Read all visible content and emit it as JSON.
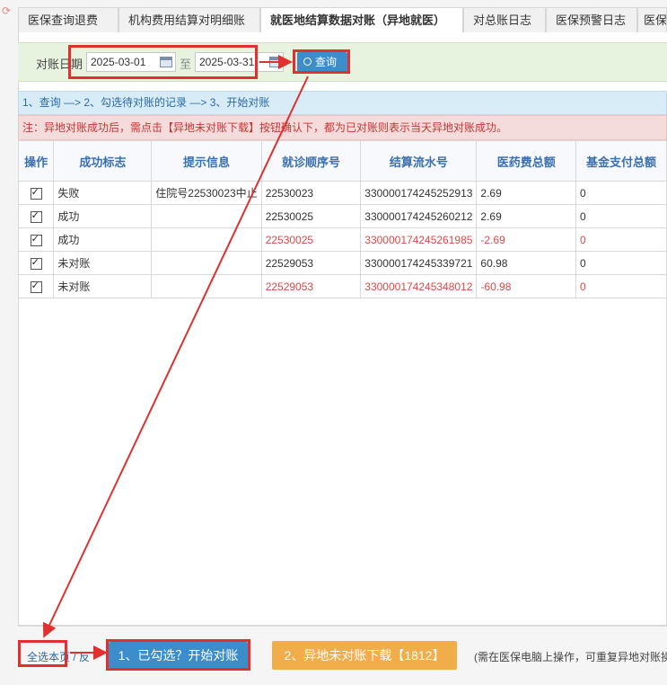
{
  "tabs": [
    {
      "label": "医保查询退费"
    },
    {
      "label": "机构费用结算对明细账"
    },
    {
      "label": "就医地结算数据对账（异地就医）"
    },
    {
      "label": "对总账日志"
    },
    {
      "label": "医保预警日志"
    },
    {
      "label": "医保"
    }
  ],
  "search": {
    "date_label": "对账日期",
    "start_date": "2025-03-01",
    "separator": "至",
    "end_date": "2025-03-31",
    "query_button": "查询"
  },
  "steps_text": "1、查询  —> 2、勾选待对账的记录  —> 3、开始对账",
  "note_text": "注：异地对账成功后，需点击【异地未对账下载】按钮确认下，都为已对账则表示当天异地对账成功。",
  "table": {
    "columns": [
      "操作",
      "成功标志",
      "提示信息",
      "就诊顺序号",
      "结算流水号",
      "医药费总额",
      "基金支付总额"
    ],
    "rows": [
      {
        "status": "失败",
        "status_type": "fail",
        "info": "住院号22530023中止",
        "visit_no": "22530023",
        "serial": "330000174245252913",
        "total": "2.69",
        "fund": "0",
        "negative": false
      },
      {
        "status": "成功",
        "status_type": "ok",
        "info": "",
        "visit_no": "22530025",
        "serial": "330000174245260212",
        "total": "2.69",
        "fund": "0",
        "negative": false
      },
      {
        "status": "成功",
        "status_type": "ok",
        "info": "",
        "visit_no": "22530025",
        "serial": "330000174245261985",
        "total": "-2.69",
        "fund": "0",
        "negative": true
      },
      {
        "status": "未对账",
        "status_type": "fail",
        "info": "",
        "visit_no": "22529053",
        "serial": "330000174245339721",
        "total": "60.98",
        "fund": "0",
        "negative": false
      },
      {
        "status": "未对账",
        "status_type": "fail",
        "info": "",
        "visit_no": "22529053",
        "serial": "330000174245348012",
        "total": "-60.98",
        "fund": "0",
        "negative": true
      }
    ]
  },
  "footer": {
    "select_all": "全选本页",
    "select_sep": "/",
    "select_suffix": "反",
    "start_button": "1、已勾选？开始对账",
    "download_button": "2、异地未对账下载【1812】",
    "hint": "(需在医保电脑上操作，可重复异地对账操"
  },
  "colors": {
    "accent": "#3c8dcc",
    "warning": "#f2ad4b",
    "error": "#e04747",
    "success": "#3aaa3a",
    "annotation": "#e03030"
  },
  "icons": [
    "reload-icon",
    "calendar-icon",
    "search-icon",
    "checkbox-checked-icon"
  ]
}
